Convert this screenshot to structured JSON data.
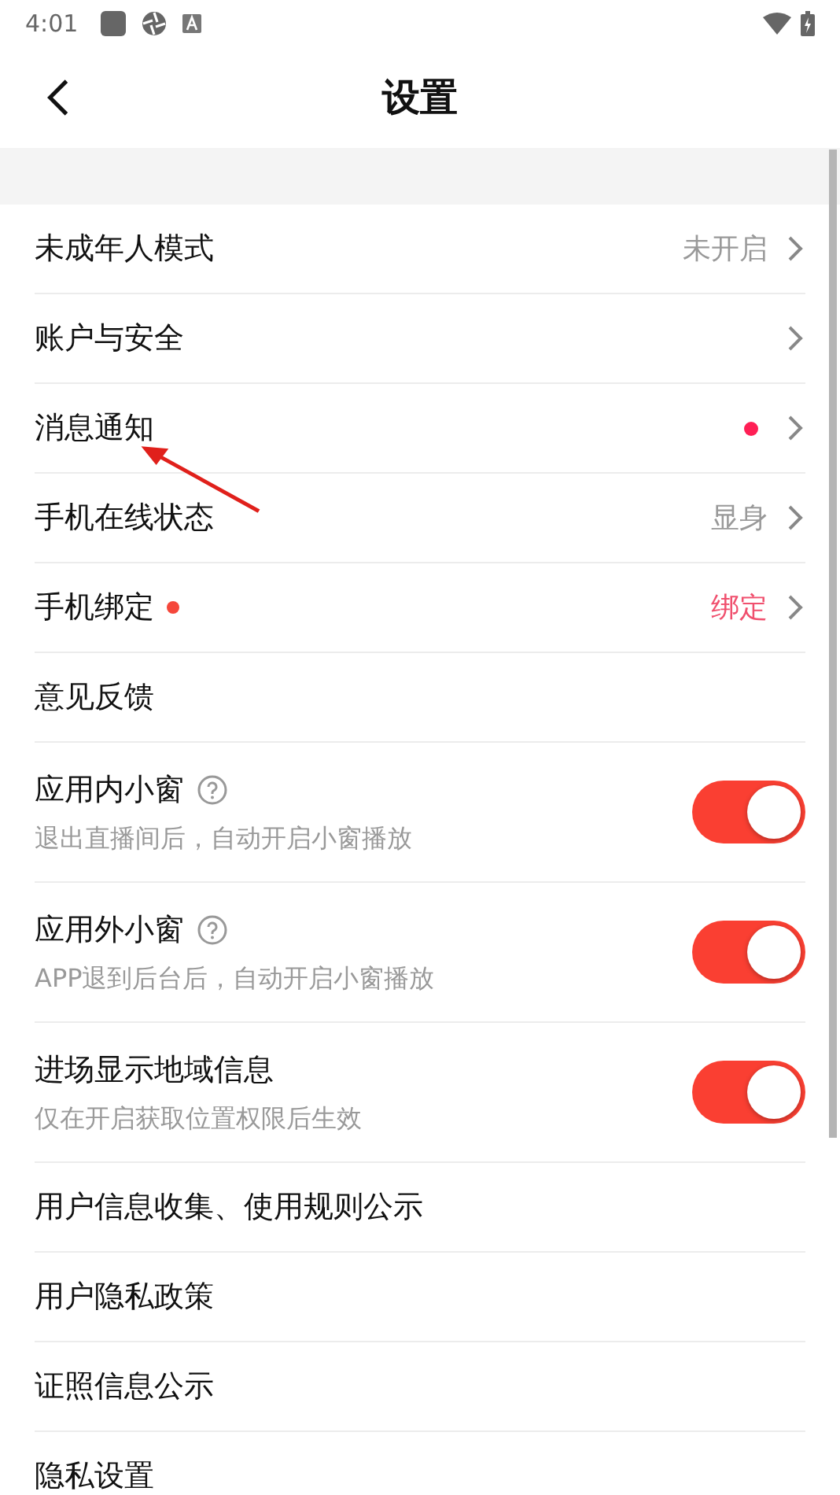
{
  "status_bar": {
    "time": "4:01"
  },
  "header": {
    "title": "设置"
  },
  "rows": [
    {
      "kind": "link",
      "label": "未成年人模式",
      "value": "未开启",
      "value_highlight": false,
      "label_dot": false,
      "badge_dot": false,
      "chevron": true
    },
    {
      "kind": "link",
      "label": "账户与安全",
      "label_dot": false,
      "badge_dot": false,
      "chevron": true
    },
    {
      "kind": "link",
      "label": "消息通知",
      "label_dot": false,
      "badge_dot": true,
      "chevron": true
    },
    {
      "kind": "link",
      "label": "手机在线状态",
      "value": "显身",
      "value_highlight": false,
      "label_dot": false,
      "badge_dot": false,
      "chevron": true
    },
    {
      "kind": "link",
      "label": "手机绑定",
      "value": "绑定",
      "value_highlight": true,
      "label_dot": true,
      "badge_dot": false,
      "chevron": true
    },
    {
      "kind": "link",
      "label": "意见反馈",
      "label_dot": false,
      "badge_dot": false,
      "chevron": false
    },
    {
      "kind": "toggle",
      "label": "应用内小窗",
      "help": true,
      "subtitle": "退出直播间后，自动开启小窗播放",
      "on": true
    },
    {
      "kind": "toggle",
      "label": "应用外小窗",
      "help": true,
      "subtitle": "APP退到后台后，自动开启小窗播放",
      "on": true
    },
    {
      "kind": "toggle",
      "label": "进场显示地域信息",
      "help": false,
      "subtitle": "仅在开启获取位置权限后生效",
      "on": true
    },
    {
      "kind": "link",
      "label": "用户信息收集、使用规则公示",
      "label_dot": false,
      "badge_dot": false,
      "chevron": false
    },
    {
      "kind": "link",
      "label": "用户隐私政策",
      "label_dot": false,
      "badge_dot": false,
      "chevron": false
    },
    {
      "kind": "link",
      "label": "证照信息公示",
      "label_dot": false,
      "badge_dot": false,
      "chevron": false
    },
    {
      "kind": "link",
      "label": "隐私设置",
      "label_dot": false,
      "badge_dot": false,
      "chevron": false
    }
  ]
}
